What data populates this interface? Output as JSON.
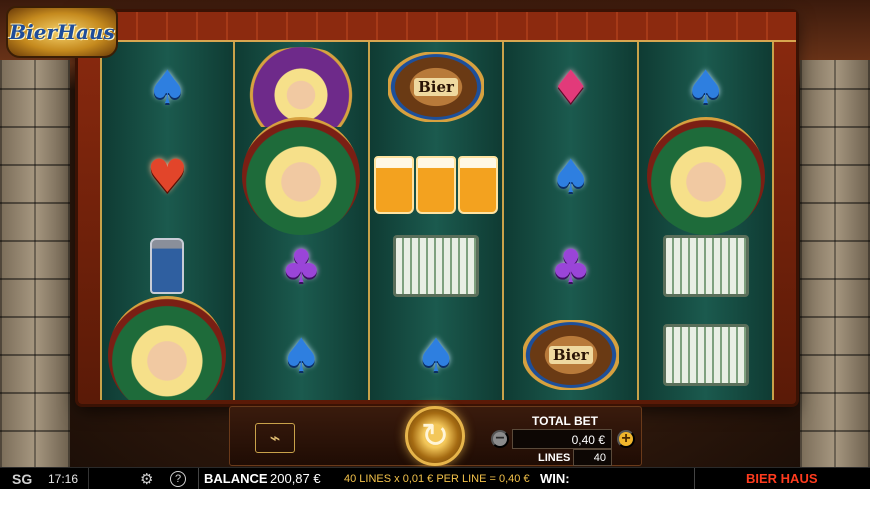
{
  "game": {
    "logo_text": "BierHaus",
    "title": "BIER HAUS"
  },
  "reels": [
    {
      "id": 1,
      "symbols": [
        "spade",
        "heart",
        "stein",
        "portrait-green"
      ]
    },
    {
      "id": 2,
      "symbols": [
        "portrait-purple",
        "portrait-green",
        "club",
        "spade"
      ]
    },
    {
      "id": 3,
      "symbols": [
        "barrel",
        "beer-mugs",
        "accordion",
        "spade"
      ]
    },
    {
      "id": 4,
      "symbols": [
        "diamond",
        "spade",
        "club",
        "barrel"
      ]
    },
    {
      "id": 5,
      "symbols": [
        "spade",
        "portrait-green",
        "accordion",
        "accordion"
      ]
    }
  ],
  "symbol_glyphs": {
    "spade": "♠",
    "heart": "♥",
    "club": "♣",
    "diamond": "♦",
    "barrel_label": "Bier"
  },
  "controls": {
    "total_bet_label": "TOTAL BET",
    "total_bet_value": "0,40 €",
    "lines_label": "LINES",
    "lines_value": "40",
    "minus_label": "−",
    "plus_label": "+",
    "spin_glyph": "↻",
    "autoplay_glyph": "⌁"
  },
  "status_bar": {
    "brand": "SG",
    "clock": "17:16",
    "balance_label": "BALANCE",
    "balance_value": "200,87 €",
    "lines_summary": "40 LINES x 0,01 € PER LINE = 0,40 €",
    "win_label": "WIN:",
    "help_glyph": "?",
    "settings_glyph": "⚙"
  },
  "colors": {
    "reel_bg": "#1b5a4e",
    "frame": "#8c2a0f",
    "gold": "#c9a24a",
    "title_red": "#ff3b1e"
  }
}
